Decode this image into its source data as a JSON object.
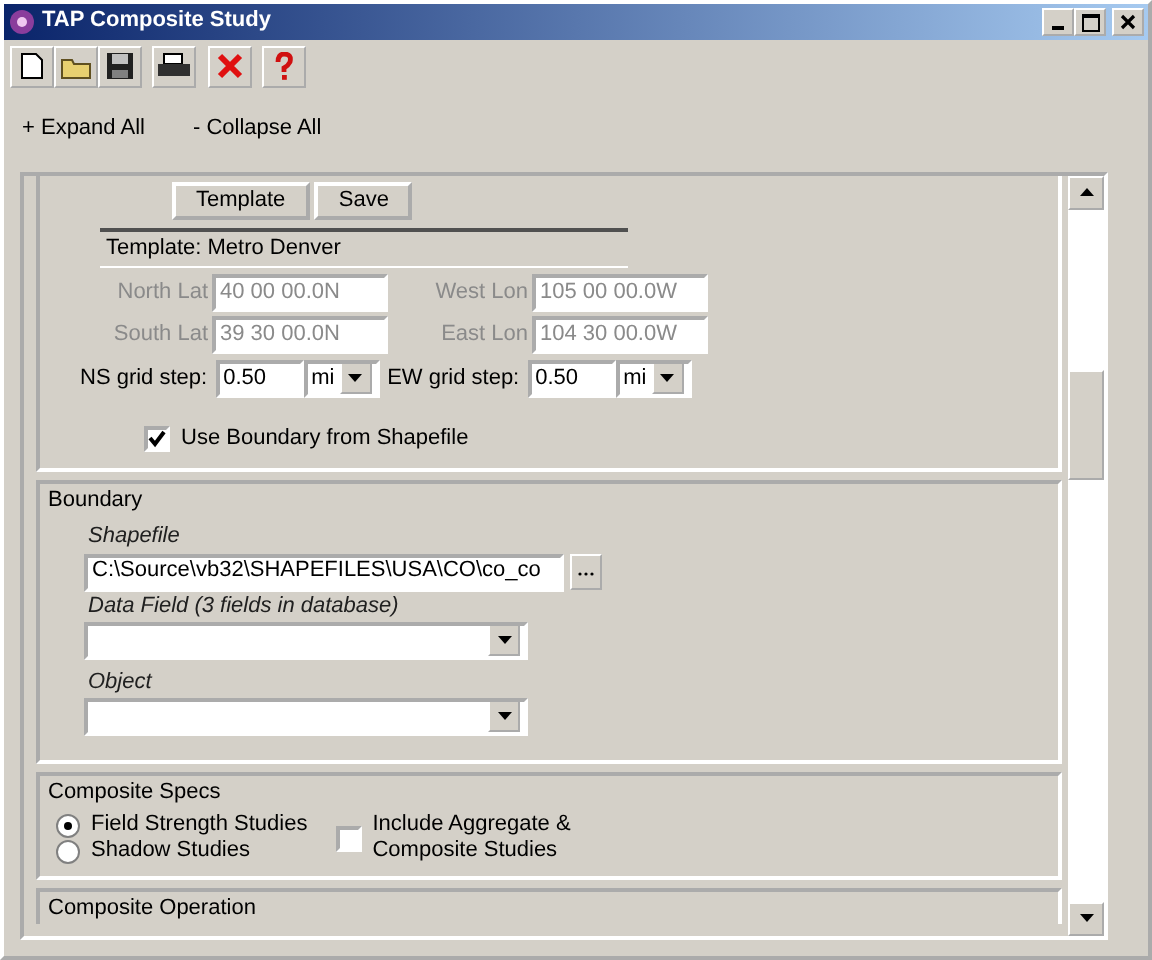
{
  "window": {
    "title": "TAP Composite Study"
  },
  "outline_links": [
    "+ Expand All",
    "- Collapse All"
  ],
  "template_section": {
    "buttons": [
      "Template",
      "Save"
    ],
    "template_label": "Template: Metro Denver",
    "coordinates": [
      {
        "label": "North Lat",
        "value": "40 00 00.0N",
        "disabled": true
      },
      {
        "label": "West Lon",
        "value": "105 00 00.0W",
        "disabled": true
      },
      {
        "label": "South Lat",
        "value": "39 30 00.0N",
        "disabled": true
      },
      {
        "label": "East Lon",
        "value": "104 30 00.0W",
        "disabled": true
      }
    ],
    "grid_steps": [
      {
        "label": "NS grid step:",
        "value": "0.50",
        "unit": "mi"
      },
      {
        "label": "EW grid step:",
        "value": "0.50",
        "unit": "mi"
      }
    ],
    "use_boundary": {
      "label": "Use Boundary from Shapefile",
      "checked": true
    }
  },
  "boundary": {
    "title": "Boundary",
    "fields": [
      {
        "label": "Shapefile",
        "value": "C:\\Source\\vb32\\SHAPEFILES\\USA\\CO\\co_co",
        "kind": "browse"
      },
      {
        "label": "Data Field (3 fields in database)",
        "kind": "dropdown"
      },
      {
        "label": "Object",
        "kind": "dropdown"
      }
    ]
  },
  "composite_specs": {
    "title": "Composite Specs",
    "study_types": [
      {
        "label": "Field Strength Studies",
        "selected": true
      },
      {
        "label": "Shadow Studies",
        "selected": false
      }
    ],
    "include_aggregate": {
      "label": "Include Aggregate & Composite Studies",
      "checked": false
    }
  },
  "composite_operation": {
    "title": "Composite Operation"
  }
}
